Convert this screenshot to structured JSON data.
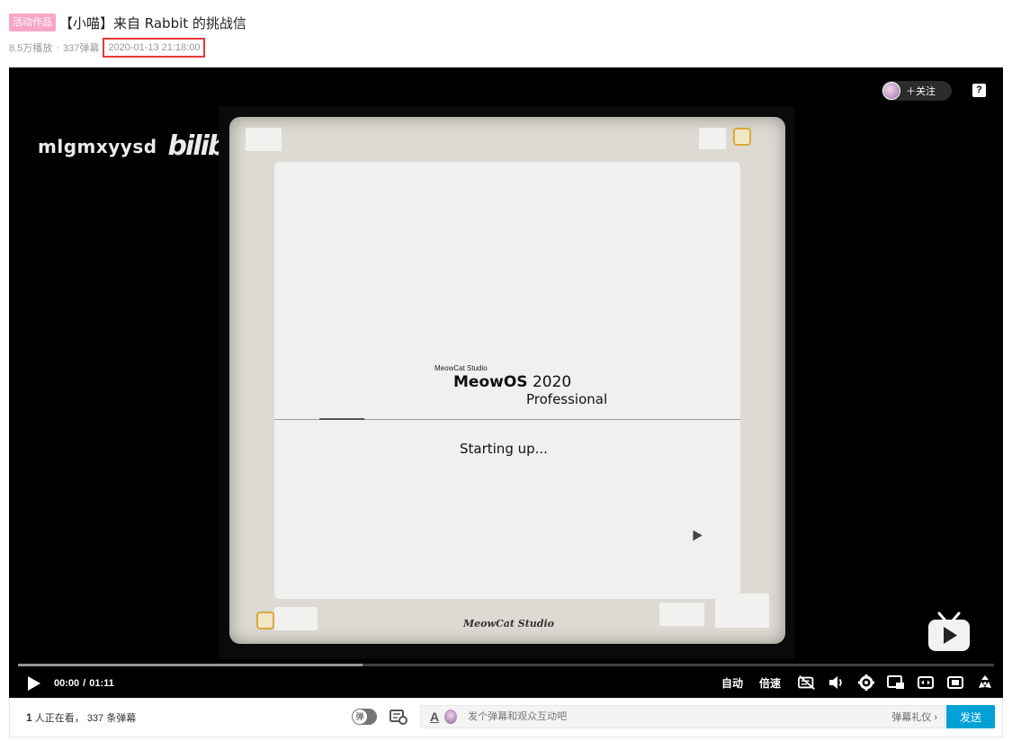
{
  "header": {
    "badge": "活动作品",
    "title": "【小喵】来自 Rabbit 的挑战信",
    "play_count": "8.5万播放",
    "separator": "·",
    "danmaku_count": "337弹幕",
    "publish_time": "2020-01-13 21:18:00"
  },
  "player": {
    "follow_label": "＋关注",
    "help_label": "?",
    "watermark_user": "mlgmxyysd",
    "watermark_logo": "bilibili",
    "video": {
      "studio_small": "MeowCat Studio",
      "os_name_bold": "MeowOS",
      "os_version": "2020",
      "os_edition": "Professional",
      "status": "Starting up...",
      "brand_bottom": "MeowCat Studio"
    },
    "progress": {
      "played_fraction": 0.0,
      "buffered_fraction": 0.353
    },
    "time": {
      "current": "00:00",
      "slash": "/",
      "total": "01:11"
    },
    "controls": {
      "auto_label": "自动",
      "speed_label": "倍速",
      "icons": [
        "danmaku-off-icon",
        "volume-icon",
        "settings-icon",
        "pip-icon",
        "widescreen-icon",
        "web-fullscreen-icon",
        "fullscreen-icon"
      ]
    },
    "colors": {
      "background": "#000000",
      "accent": "#00a1d6",
      "date_highlight": "#e53935",
      "badge": "#f8a6c8"
    }
  },
  "danmaku_bar": {
    "viewers_count": "1",
    "viewers_label": "人正在看，",
    "danmaku_count": "337",
    "danmaku_label": "条弹幕",
    "toggle_label": "弹",
    "font_icon_label": "A",
    "input_placeholder": "发个弹幕和观众互动吧",
    "etiquette_label": "弹幕礼仪 ›",
    "send_label": "发送"
  }
}
